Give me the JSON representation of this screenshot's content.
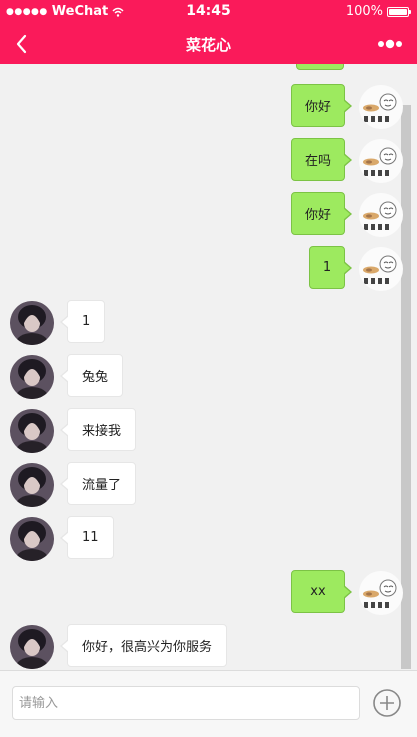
{
  "status_bar": {
    "signal": "●●●●●",
    "carrier": "WeChat",
    "time": "14:45",
    "battery_percent": "100%"
  },
  "nav_bar": {
    "title": "菜花心",
    "back_icon": "chevron-left-icon",
    "more_icon": "more-dots-icon"
  },
  "messages": [
    {
      "side": "right",
      "text": "你好"
    },
    {
      "side": "right",
      "text": "在吗"
    },
    {
      "side": "right",
      "text": "你好"
    },
    {
      "side": "right",
      "text": "1"
    },
    {
      "side": "left",
      "text": "1"
    },
    {
      "side": "left",
      "text": "兔兔"
    },
    {
      "side": "left",
      "text": "来接我"
    },
    {
      "side": "left",
      "text": "流量了"
    },
    {
      "side": "left",
      "text": "11"
    },
    {
      "side": "right",
      "text": "xx"
    },
    {
      "side": "left",
      "text": "你好，很高兴为你服务"
    }
  ],
  "input_bar": {
    "placeholder": "请输入",
    "add_icon": "plus-circle-icon"
  },
  "colors": {
    "brand": "#fa1a5a",
    "outgoing_bubble": "#9dea5f",
    "incoming_bubble": "#ffffff",
    "background": "#f1f1f1"
  }
}
